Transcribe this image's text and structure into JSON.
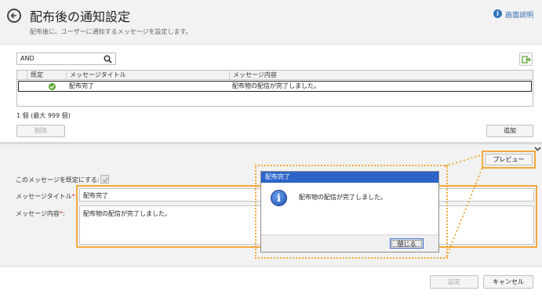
{
  "header": {
    "title": "配布後の通知設定",
    "subtitle": "配布後に、ユーザーに通知するメッセージを設定します。",
    "help_label": "画面説明"
  },
  "search": {
    "value": "AND"
  },
  "table": {
    "columns": [
      "既定",
      "メッセージタイトル",
      "メッセージ内容"
    ],
    "rows": [
      {
        "default": true,
        "title": "配布完了",
        "content": "配布物の配信が完了しました。"
      }
    ]
  },
  "count_text": "1 個 (最大 999 個)",
  "buttons": {
    "delete": "削除",
    "add": "追加",
    "preview": "プレビュー",
    "apply": "設定",
    "cancel": "キャンセル"
  },
  "form": {
    "default_label": "このメッセージを既定にする:",
    "title_label": "メッセージタイトル",
    "title_value": "配布完了",
    "content_label": "メッセージ内容",
    "content_value": "配布物の配信が完了しました。",
    "required_mark": "*",
    "colon": ":"
  },
  "dialog": {
    "title": "配布完了",
    "message": "配布物の配信が完了しました。",
    "close_label": "閉じる",
    "icon_glyph": "i"
  },
  "colors": {
    "highlight": "#f2a93b",
    "dialog_title": "#2d64c8",
    "link": "#2f6db5"
  }
}
